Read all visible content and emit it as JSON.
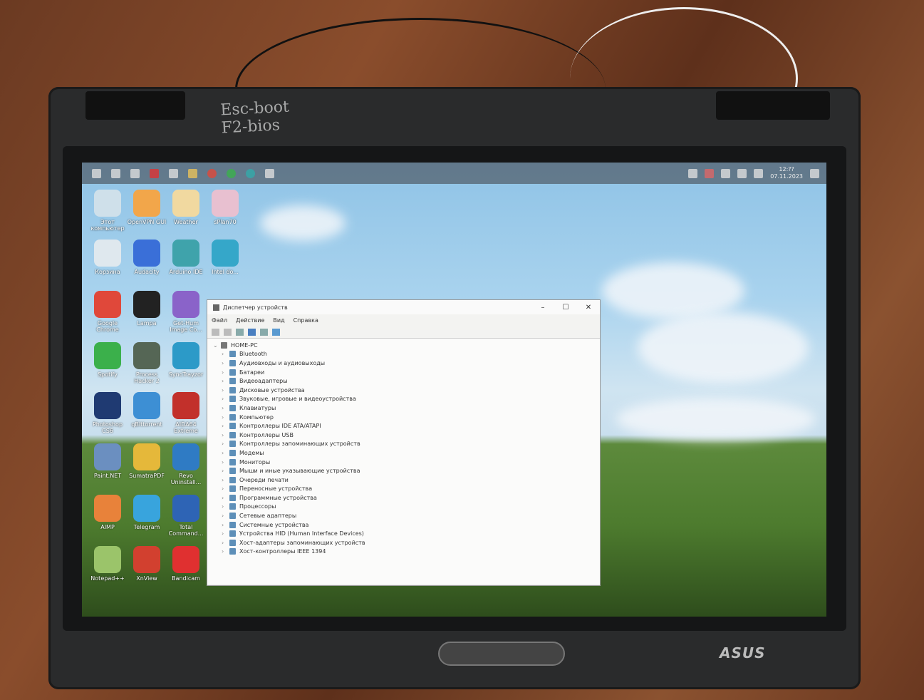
{
  "taskbar": {
    "date": "07.11.2023",
    "time": "12:??"
  },
  "desktop_icons": [
    {
      "label": "Этот компьютер",
      "color": "#cfe0ea"
    },
    {
      "label": "OpenVPN GUI",
      "color": "#f2a64a"
    },
    {
      "label": "Weather",
      "color": "#f1d9a0"
    },
    {
      "label": "sPlan70",
      "color": "#e8c0d0"
    },
    {
      "label": "Корзина",
      "color": "#dfe8ee"
    },
    {
      "label": "Audacity",
      "color": "#3a6fd8"
    },
    {
      "label": "Arduino IDE",
      "color": "#3fa3ab"
    },
    {
      "label": "Intel do...",
      "color": "#35a7c9"
    },
    {
      "label": "Google Chrome",
      "color": "#e0483a"
    },
    {
      "label": "Lampa",
      "color": "#222222"
    },
    {
      "label": "Get-Hum Image Co...",
      "color": "#8a63c9"
    },
    {
      "label": "Spotify",
      "color": "#3bb04b"
    },
    {
      "label": "Process Hacker 2",
      "color": "#556655"
    },
    {
      "label": "SyncTrayzor",
      "color": "#2c9ac8"
    },
    {
      "label": "Photoshop CS6",
      "color": "#1f3a72"
    },
    {
      "label": "qBittorrent",
      "color": "#3d8fd4"
    },
    {
      "label": "AIDA64 Extreme",
      "color": "#c2302b"
    },
    {
      "label": "Paint.NET",
      "color": "#6b8fc0"
    },
    {
      "label": "SumatraPDF",
      "color": "#e5b83a"
    },
    {
      "label": "Revo Uninstall...",
      "color": "#2f7bc4"
    },
    {
      "label": "AIMP",
      "color": "#e8823a"
    },
    {
      "label": "Telegram",
      "color": "#38a4dd"
    },
    {
      "label": "Total Command...",
      "color": "#2e64b5"
    },
    {
      "label": "Notepad++",
      "color": "#9bc46a"
    },
    {
      "label": "XnView",
      "color": "#d2402f"
    },
    {
      "label": "Bandicam",
      "color": "#e03030"
    }
  ],
  "device_manager": {
    "title": "Диспетчер устройств",
    "menu": [
      "Файл",
      "Действие",
      "Вид",
      "Справка"
    ],
    "root": "HOME-PC",
    "categories": [
      "Bluetooth",
      "Аудиовходы и аудиовыходы",
      "Батареи",
      "Видеоадаптеры",
      "Дисковые устройства",
      "Звуковые, игровые и видеоустройства",
      "Клавиатуры",
      "Компьютер",
      "Контроллеры IDE ATA/ATAPI",
      "Контроллеры USB",
      "Контроллеры запоминающих устройств",
      "Модемы",
      "Мониторы",
      "Мыши и иные указывающие устройства",
      "Очереди печати",
      "Переносные устройства",
      "Программные устройства",
      "Процессоры",
      "Сетевые адаптеры",
      "Системные устройства",
      "Устройства HID (Human Interface Devices)",
      "Хост-адаптеры запоминающих устройств",
      "Хост-контроллеры IEEE 1394"
    ]
  },
  "laptop": {
    "brand": "ASUS",
    "handwriting": "Esc-boot F2-bios"
  }
}
